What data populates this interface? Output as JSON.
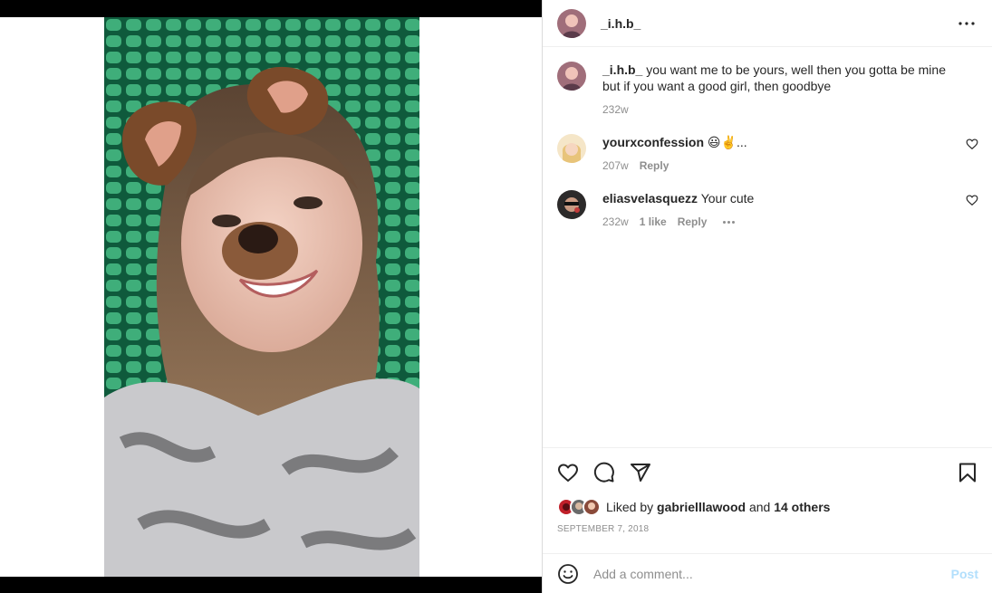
{
  "post": {
    "username": "_i.h.b_"
  },
  "comments": [
    {
      "username": "_i.h.b_",
      "text": "you want me to be yours, well then you gotta be mine but if you want a good girl, then goodbye",
      "age": "232w"
    },
    {
      "username": "yourxconfession",
      "text": "😃✌️...",
      "age": "207w",
      "reply": "Reply"
    },
    {
      "username": "eliasvelasquezz",
      "text": "Your cute",
      "age": "232w",
      "likes": "1 like",
      "reply": "Reply"
    }
  ],
  "likes": {
    "prefix": "Liked by",
    "user": "gabrielllawood",
    "joiner": "and",
    "others": "14 others"
  },
  "date": "SEPTEMBER 7, 2018",
  "add_comment": {
    "placeholder": "Add a comment...",
    "post_label": "Post"
  },
  "icons": {
    "more": "more-horizontal-icon",
    "like": "heart-icon",
    "comment": "comment-icon",
    "share": "paper-plane-icon",
    "save": "bookmark-icon",
    "emoji": "emoji-icon"
  },
  "colors": {
    "post_button": "#b2dffc",
    "muted": "#8e8e8e",
    "text": "#262626"
  }
}
